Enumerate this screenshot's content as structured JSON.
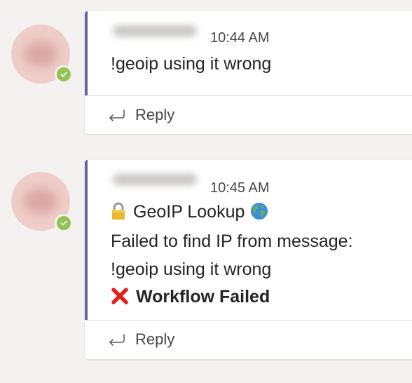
{
  "threads": [
    {
      "timestamp": "10:44 AM",
      "lines": [
        "!geoip using it wrong"
      ],
      "reply_label": "Reply"
    },
    {
      "timestamp": "10:45 AM",
      "header": "GeoIP Lookup",
      "lines": [
        "Failed to find IP from message:",
        "!geoip using it wrong"
      ],
      "status": "Workflow Failed",
      "reply_label": "Reply"
    }
  ],
  "colors": {
    "accent_bar": "#6264a7",
    "presence_available": "#92c353",
    "failure_x": "#e0201e"
  },
  "icons": {
    "presence": "check-icon",
    "reply": "reply-arrow-icon",
    "header_left": "lock-icon",
    "header_right": "globe-icon",
    "status": "red-x-icon"
  }
}
